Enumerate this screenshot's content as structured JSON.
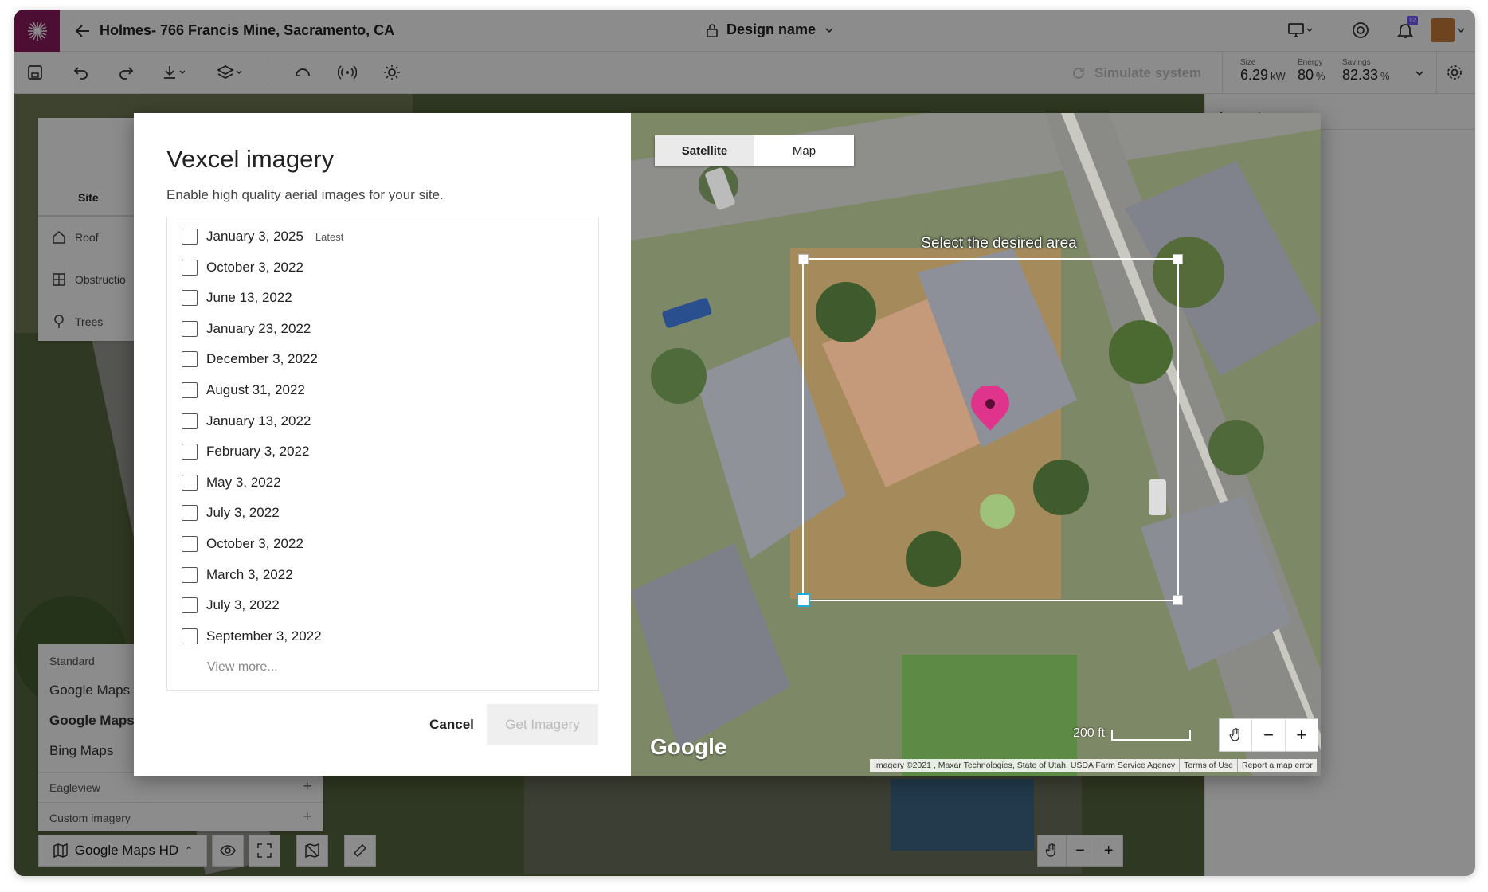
{
  "header": {
    "project_title": "Holmes- 766 Francis Mine, Sacramento, CA",
    "design_name": "Design name",
    "notification_count": "12"
  },
  "toolbar": {
    "simulate_label": "Simulate system",
    "stats": [
      {
        "label": "Size",
        "value": "6.29",
        "unit": "kW"
      },
      {
        "label": "Energy",
        "value": "80",
        "unit": "%"
      },
      {
        "label": "Savings",
        "value": "82.33",
        "unit": "%"
      }
    ]
  },
  "inspector": {
    "title": "Inspector"
  },
  "left_panel": {
    "tab_site": "Site",
    "items": [
      {
        "label": "Roof",
        "icon": "home-icon"
      },
      {
        "label": "Obstructio",
        "icon": "obstruction-icon"
      },
      {
        "label": "Trees",
        "icon": "tree-icon"
      }
    ]
  },
  "layer_panel": {
    "standard_heading": "Standard",
    "standard_items": [
      "Google Maps",
      "Google Maps",
      "Bing Maps"
    ],
    "eagleview": "Eagleview",
    "custom_imagery": "Custom imagery",
    "current_layer": "Google Maps HD"
  },
  "modal": {
    "title": "Vexcel imagery",
    "subtitle": "Enable high quality aerial images for your site.",
    "dates": [
      {
        "label": "January 3, 2025",
        "tag": "Latest"
      },
      {
        "label": "October 3, 2022",
        "tag": ""
      },
      {
        "label": "June 13, 2022",
        "tag": ""
      },
      {
        "label": "January 23, 2022",
        "tag": ""
      },
      {
        "label": "December 3, 2022",
        "tag": ""
      },
      {
        "label": "August 31, 2022",
        "tag": ""
      },
      {
        "label": "January 13, 2022",
        "tag": ""
      },
      {
        "label": "February 3, 2022",
        "tag": ""
      },
      {
        "label": "May 3, 2022",
        "tag": ""
      },
      {
        "label": "July 3, 2022",
        "tag": ""
      },
      {
        "label": "October 3, 2022",
        "tag": ""
      },
      {
        "label": "March 3, 2022",
        "tag": ""
      },
      {
        "label": "July 3, 2022",
        "tag": ""
      },
      {
        "label": "September 3, 2022",
        "tag": ""
      }
    ],
    "view_more": "View more...",
    "cancel_label": "Cancel",
    "get_imagery_label": "Get Imagery",
    "map": {
      "tab_satellite": "Satellite",
      "tab_map": "Map",
      "select_label": "Select the desired area",
      "google_watermark": "Google",
      "scale_label": "200 ft",
      "attribution": [
        "Imagery ©2021 , Maxar Technologies, State of Utah, USDA Farm Service Agency",
        "Terms of Use",
        "Report a map error"
      ]
    }
  },
  "colors": {
    "brand": "#8b1a5c",
    "pin": "#e0338c",
    "accent": "#7b5cff"
  }
}
